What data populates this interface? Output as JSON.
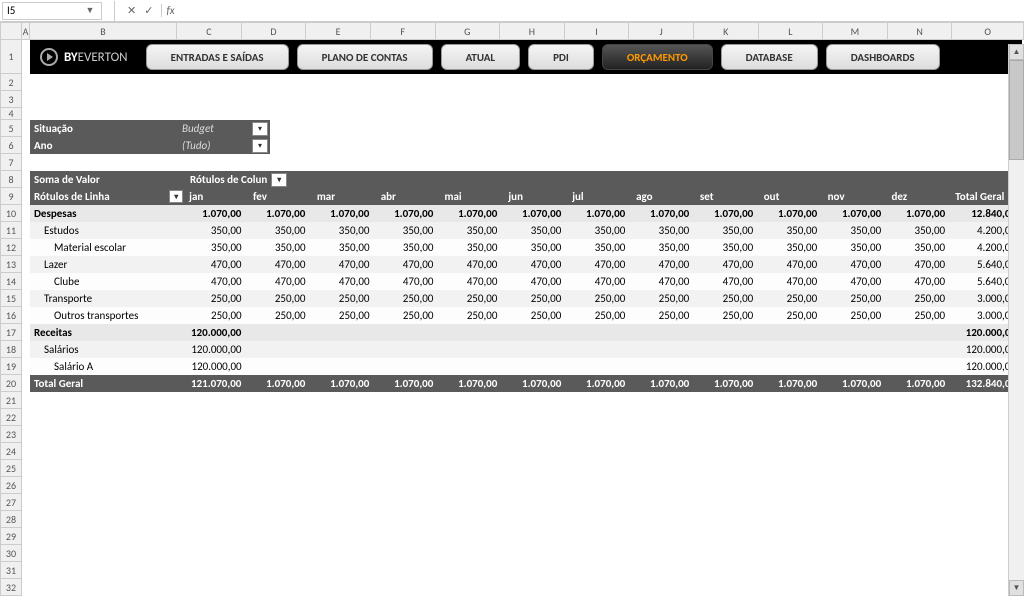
{
  "name_box": "I5",
  "fx": "fx",
  "columns": [
    "A",
    "B",
    "C",
    "D",
    "E",
    "F",
    "G",
    "H",
    "I",
    "J",
    "K",
    "L",
    "M",
    "N",
    "O"
  ],
  "logo": {
    "by": "BY",
    "name": "EVERTON"
  },
  "tabs": [
    {
      "label": "ENTRADAS E SAÍDAS",
      "active": false
    },
    {
      "label": "PLANO DE CONTAS",
      "active": false
    },
    {
      "label": "ATUAL",
      "active": false
    },
    {
      "label": "PDI",
      "active": false
    },
    {
      "label": "ORÇAMENTO",
      "active": true
    },
    {
      "label": "DATABASE",
      "active": false
    },
    {
      "label": "DASHBOARDS",
      "active": false
    }
  ],
  "filters": {
    "situacao": {
      "label": "Situação",
      "value": "Budget"
    },
    "ano": {
      "label": "Ano",
      "value": "(Tudo)"
    }
  },
  "pivot": {
    "sum_label": "Soma de Valor",
    "col_label": "Rótulos de Colun",
    "row_label": "Rótulos de Linha",
    "months": [
      "jan",
      "fev",
      "mar",
      "abr",
      "mai",
      "jun",
      "jul",
      "ago",
      "set",
      "out",
      "nov",
      "dez"
    ],
    "total_label": "Total Geral"
  },
  "rows": [
    {
      "level": "cat",
      "label": "Despesas",
      "vals": [
        "1.070,00",
        "1.070,00",
        "1.070,00",
        "1.070,00",
        "1.070,00",
        "1.070,00",
        "1.070,00",
        "1.070,00",
        "1.070,00",
        "1.070,00",
        "1.070,00",
        "1.070,00"
      ],
      "total": "12.840,00"
    },
    {
      "level": "sub",
      "label": "Estudos",
      "vals": [
        "350,00",
        "350,00",
        "350,00",
        "350,00",
        "350,00",
        "350,00",
        "350,00",
        "350,00",
        "350,00",
        "350,00",
        "350,00",
        "350,00"
      ],
      "total": "4.200,00"
    },
    {
      "level": "sub2",
      "label": "Material escolar",
      "vals": [
        "350,00",
        "350,00",
        "350,00",
        "350,00",
        "350,00",
        "350,00",
        "350,00",
        "350,00",
        "350,00",
        "350,00",
        "350,00",
        "350,00"
      ],
      "total": "4.200,00"
    },
    {
      "level": "sub",
      "label": "Lazer",
      "vals": [
        "470,00",
        "470,00",
        "470,00",
        "470,00",
        "470,00",
        "470,00",
        "470,00",
        "470,00",
        "470,00",
        "470,00",
        "470,00",
        "470,00"
      ],
      "total": "5.640,00"
    },
    {
      "level": "sub2",
      "label": "Clube",
      "vals": [
        "470,00",
        "470,00",
        "470,00",
        "470,00",
        "470,00",
        "470,00",
        "470,00",
        "470,00",
        "470,00",
        "470,00",
        "470,00",
        "470,00"
      ],
      "total": "5.640,00"
    },
    {
      "level": "sub",
      "label": "Transporte",
      "vals": [
        "250,00",
        "250,00",
        "250,00",
        "250,00",
        "250,00",
        "250,00",
        "250,00",
        "250,00",
        "250,00",
        "250,00",
        "250,00",
        "250,00"
      ],
      "total": "3.000,00"
    },
    {
      "level": "sub2",
      "label": "Outros transportes",
      "vals": [
        "250,00",
        "250,00",
        "250,00",
        "250,00",
        "250,00",
        "250,00",
        "250,00",
        "250,00",
        "250,00",
        "250,00",
        "250,00",
        "250,00"
      ],
      "total": "3.000,00"
    },
    {
      "level": "cat",
      "label": "Receitas",
      "vals": [
        "120.000,00",
        "",
        "",
        "",
        "",
        "",
        "",
        "",
        "",
        "",
        "",
        ""
      ],
      "total": "120.000,00"
    },
    {
      "level": "sub",
      "label": "Salários",
      "vals": [
        "120.000,00",
        "",
        "",
        "",
        "",
        "",
        "",
        "",
        "",
        "",
        "",
        ""
      ],
      "total": "120.000,00"
    },
    {
      "level": "sub2",
      "label": "Salário A",
      "vals": [
        "120.000,00",
        "",
        "",
        "",
        "",
        "",
        "",
        "",
        "",
        "",
        "",
        ""
      ],
      "total": "120.000,00"
    }
  ],
  "grand_total": {
    "label": "Total Geral",
    "vals": [
      "121.070,00",
      "1.070,00",
      "1.070,00",
      "1.070,00",
      "1.070,00",
      "1.070,00",
      "1.070,00",
      "1.070,00",
      "1.070,00",
      "1.070,00",
      "1.070,00",
      "1.070,00"
    ],
    "total": "132.840,00"
  }
}
